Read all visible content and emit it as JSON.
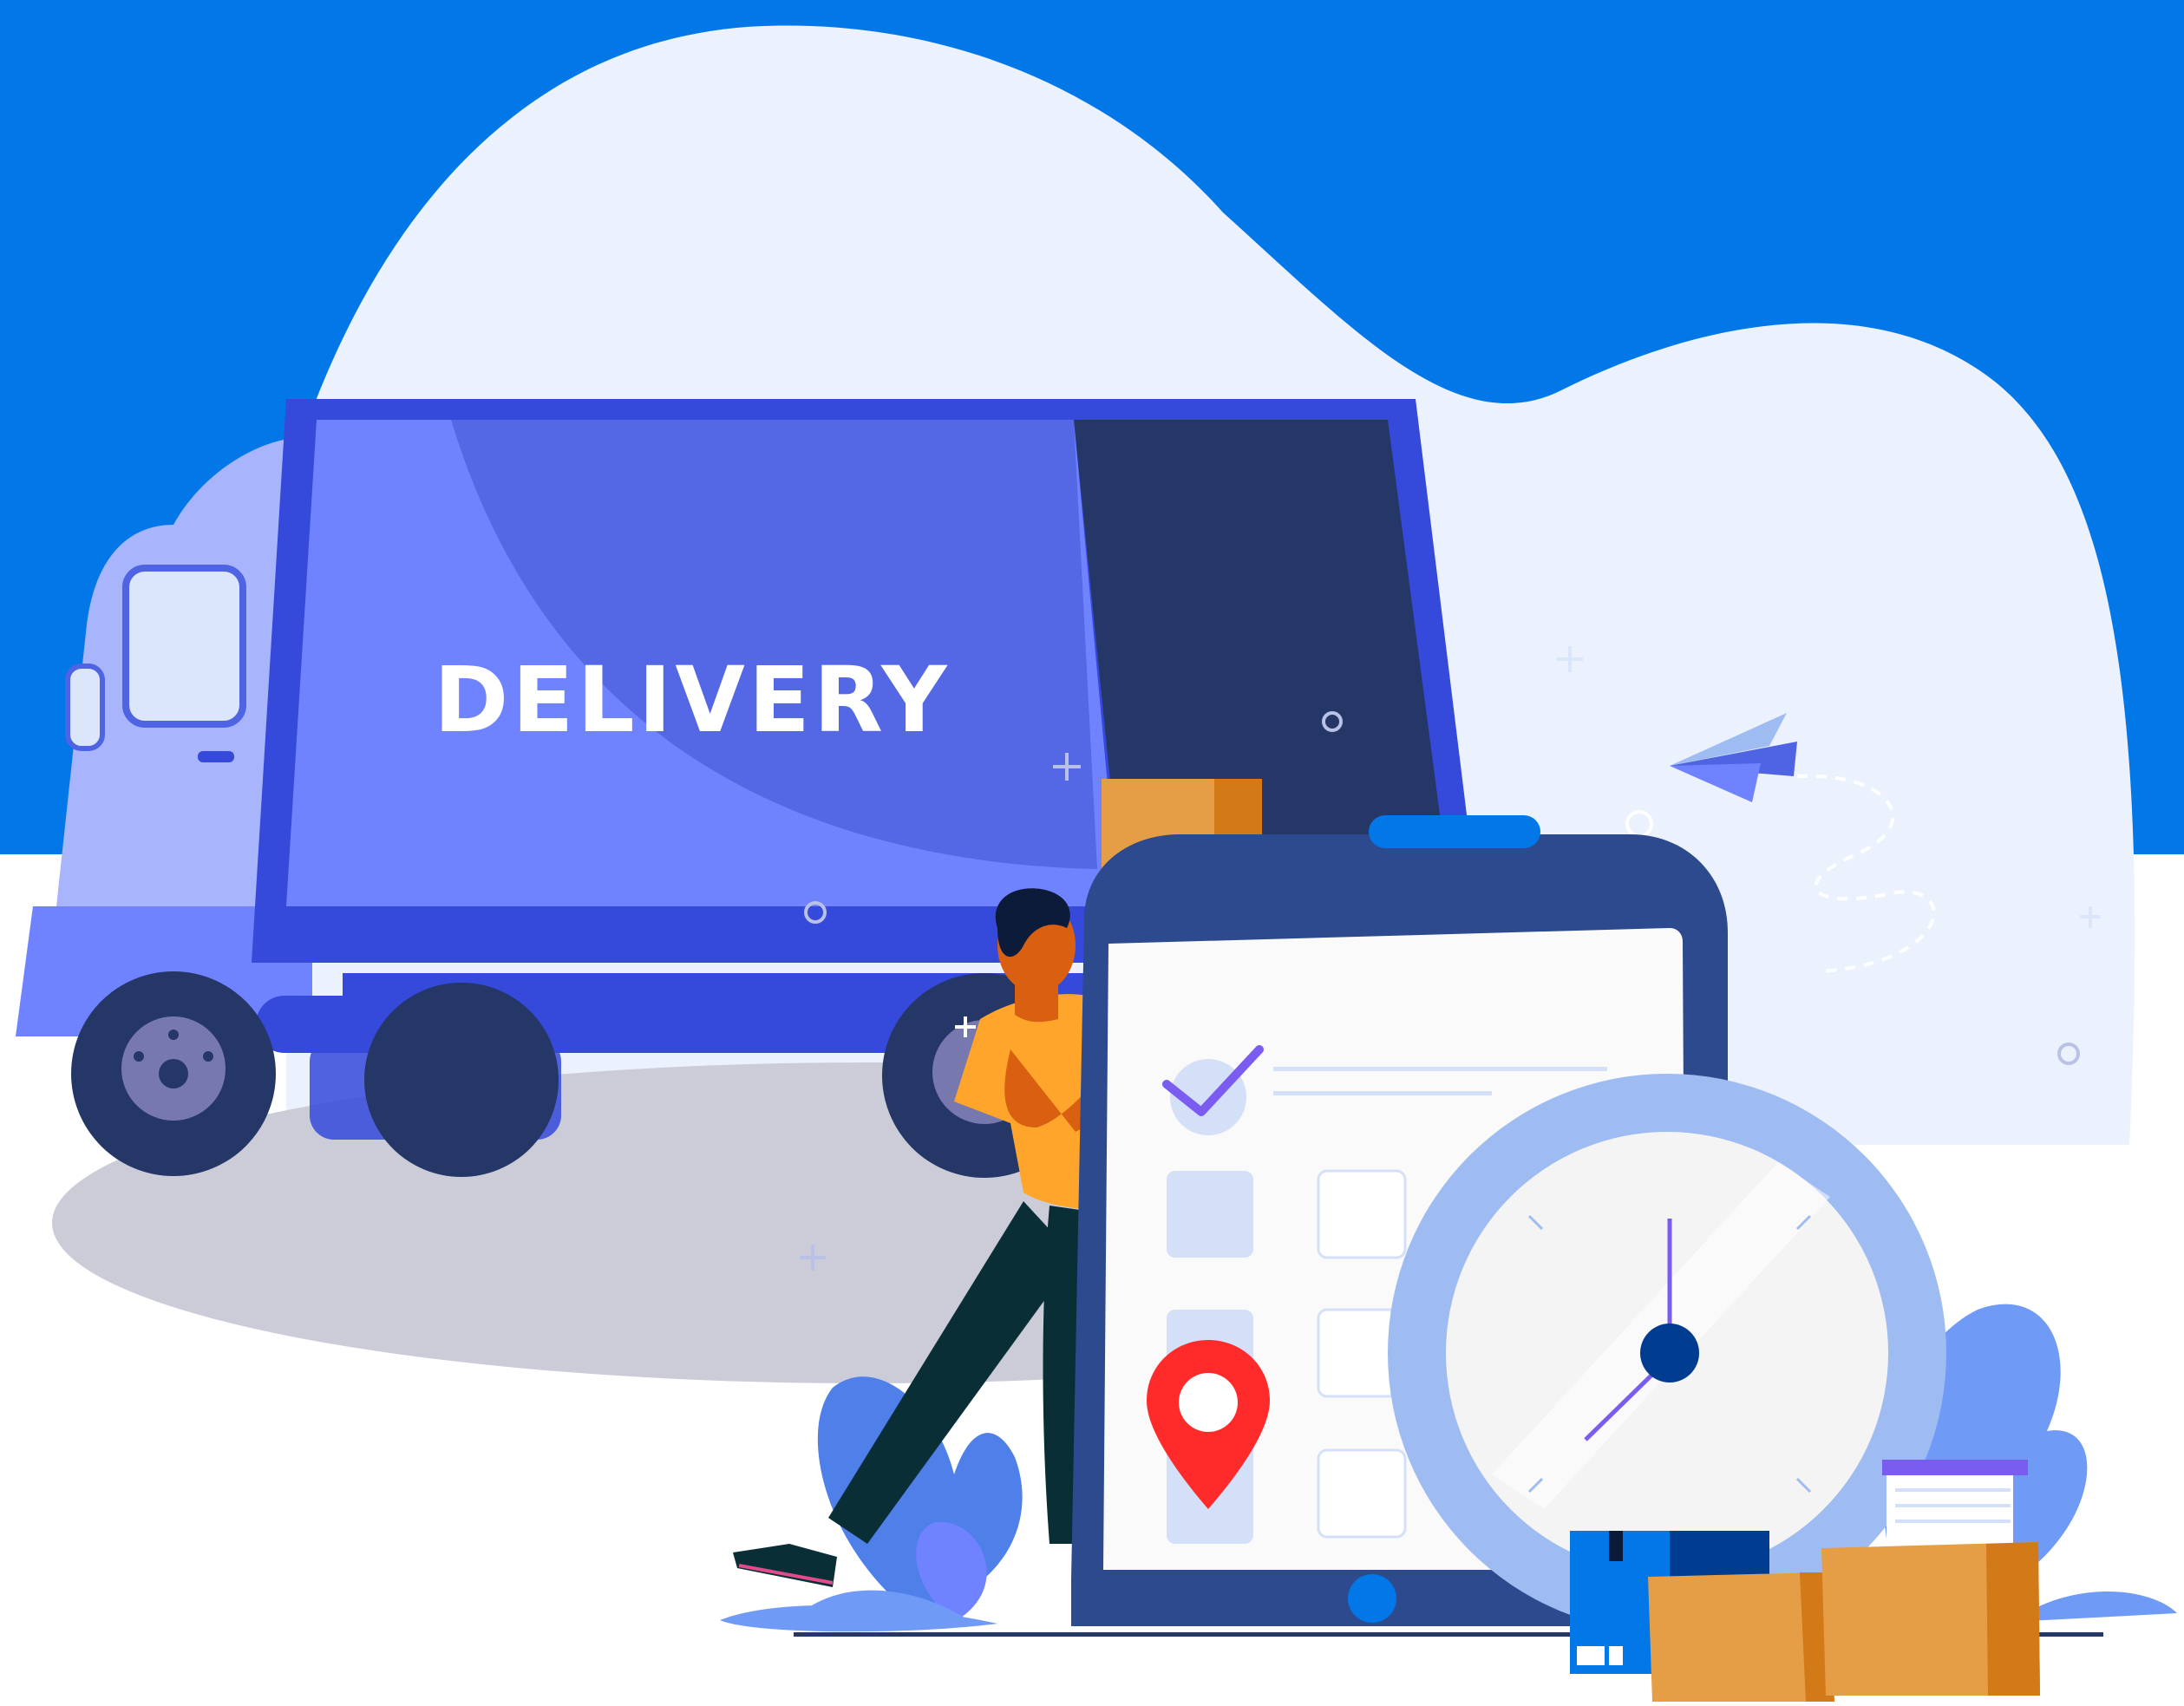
{
  "truck": {
    "label": "DELIVERY"
  },
  "colors": {
    "sky_blue": "#0277E8",
    "cloud": "#EBF2FD",
    "truck_dark": "#3549DA",
    "truck_body": "#6F82FF",
    "truck_shade": "#5468E6",
    "cab": "#A8B4FB",
    "door": "#253766",
    "tablet_frame": "#2D4A8E",
    "clock_ring": "#9FBCF2",
    "box_orange": "#E59E45",
    "box_dark": "#D27A18",
    "pin_red": "#FF2B2B",
    "check_purple": "#7B5CF0"
  },
  "icons": [
    "paper-plane-icon",
    "map-pin-icon",
    "clock-icon",
    "checkmark-icon"
  ]
}
